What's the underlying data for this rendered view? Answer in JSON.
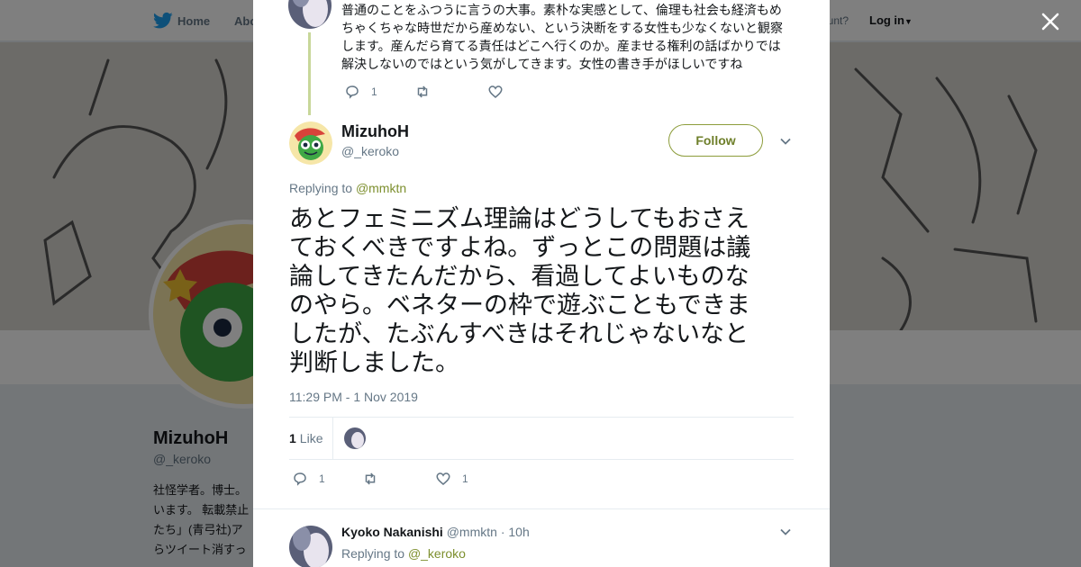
{
  "topbar": {
    "home_label": "Home",
    "about_label": "Abo",
    "account_text": "ccount?",
    "login_label": "Log in"
  },
  "profile": {
    "name": "MizuhoH",
    "handle": "@_keroko",
    "bio_lines": [
      "社怪学者。博士。",
      "います。 転載禁止",
      "たち」(青弓社)ア",
      "らツイート消すっ"
    ]
  },
  "parent_tweet": {
    "text_lines": [
      "普通のことをふつうに言うの大事。素朴な実感として、倫理も社会も経済もめ",
      "ちゃくちゃな時世だから産めない、という決断をする女性も少なくないと観察",
      "します。産んだら育てる責任はどこへ行くのか。産ませる権利の話ばかりでは",
      "解決しないのではという気がしてきます。女性の書き手がほしいですね"
    ],
    "reply_count": "1"
  },
  "main_tweet": {
    "author_name": "MizuhoH",
    "author_handle": "@_keroko",
    "follow_label": "Follow",
    "replying_prefix": "Replying to",
    "replying_to": "@mmktn",
    "text_lines": [
      "あとフェミニズム理論はどうしてもおさえ",
      "ておくべきですよね。ずっとこの問題は議",
      "論してきたんだから、看過してよいものな",
      "のやら。ベネターの枠で遊ぶこともできま",
      "したが、たぶんすべきはそれじゃないなと",
      "判断しました。"
    ],
    "timestamp": "11:29 PM - 1 Nov 2019",
    "like_count": "1",
    "like_label": "Like",
    "reply_count": "1",
    "favorite_count": "1"
  },
  "reply_tweet": {
    "author_name": "Kyoko Nakanishi",
    "author_handle": "@mmktn",
    "time_sep": "·",
    "time": "10h",
    "replying_prefix": "Replying to",
    "replying_to": "@_keroko"
  },
  "colors": {
    "accent_green": "#7d8f2e",
    "twitter_blue": "#1da1f2",
    "muted_text": "#657786"
  }
}
